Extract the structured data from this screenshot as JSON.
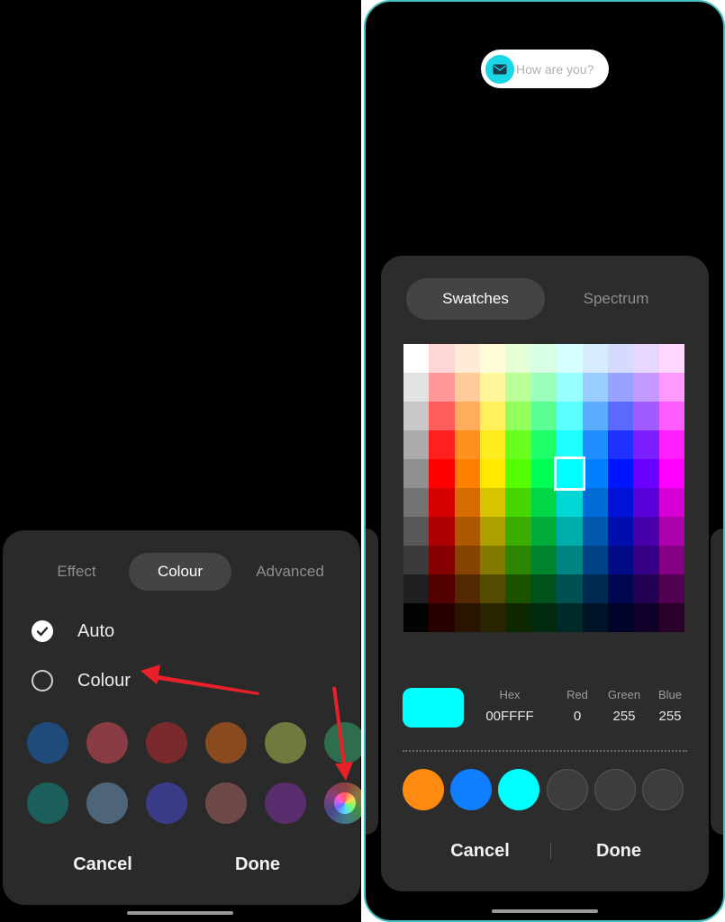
{
  "left": {
    "tabs": [
      {
        "label": "Effect",
        "active": false
      },
      {
        "label": "Colour",
        "active": true
      },
      {
        "label": "Advanced",
        "active": false
      }
    ],
    "options": [
      {
        "label": "Auto",
        "selected": true
      },
      {
        "label": "Colour",
        "selected": false
      }
    ],
    "swatches_row1": [
      "#1f4a7a",
      "#8a3c44",
      "#7a2a2d",
      "#8a4a1f",
      "#6e7a3e",
      "#2e6e4e"
    ],
    "swatches_row2": [
      "#1c5e5c",
      "#4e6478",
      "#3a3c8a",
      "#6e4a46",
      "#5a2e6e",
      "color-wheel"
    ],
    "cancel_label": "Cancel",
    "done_label": "Done"
  },
  "right": {
    "notification": {
      "text": "How are you?",
      "icon": "mail-icon",
      "accent": "#1ad7e6"
    },
    "tabs": [
      {
        "label": "Swatches",
        "active": true
      },
      {
        "label": "Spectrum",
        "active": false
      }
    ],
    "selected_color": "#00FFFF",
    "values": {
      "hex_label": "Hex",
      "hex": "00FFFF",
      "red_label": "Red",
      "red": "0",
      "green_label": "Green",
      "green": "255",
      "blue_label": "Blue",
      "blue": "255"
    },
    "recent_colors": [
      "#ff8a12",
      "#0f7fff",
      "#00ffff",
      "empty",
      "empty",
      "empty"
    ],
    "cancel_label": "Cancel",
    "done_label": "Done"
  },
  "annotation_color": "#e8202a"
}
